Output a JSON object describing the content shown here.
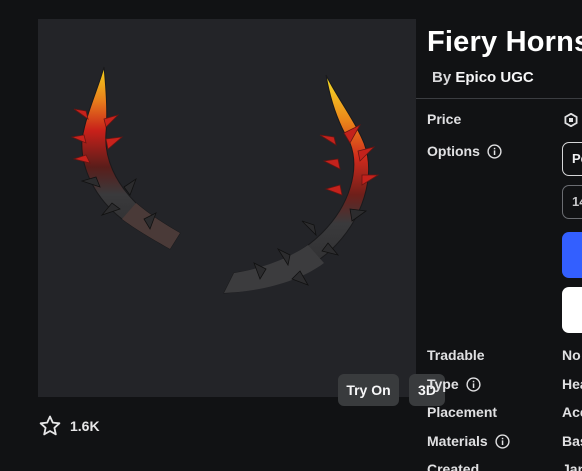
{
  "preview": {
    "try_on_label": "Try On",
    "view_3d_label": "3D"
  },
  "favorites": {
    "count": "1.6K"
  },
  "item": {
    "title": "Fiery Horns",
    "by_prefix": "By",
    "creator": "Epico UGC"
  },
  "details": {
    "price_label": "Price",
    "options_label": "Options",
    "option_1_value": "Pe",
    "option_2_value": "14",
    "tradable_label": "Tradable",
    "tradable_value": "No",
    "type_label": "Type",
    "type_value": "Hea",
    "placement_label": "Placement",
    "placement_value": "Acc",
    "materials_label": "Materials",
    "materials_value": "Bas",
    "created_label": "Created",
    "created_value": "Jan"
  },
  "colors": {
    "page_bg": "#111214",
    "panel_bg": "#232428",
    "accent_blue": "#335fff"
  },
  "icons": [
    "star-icon",
    "info-icon",
    "robux-icon"
  ]
}
